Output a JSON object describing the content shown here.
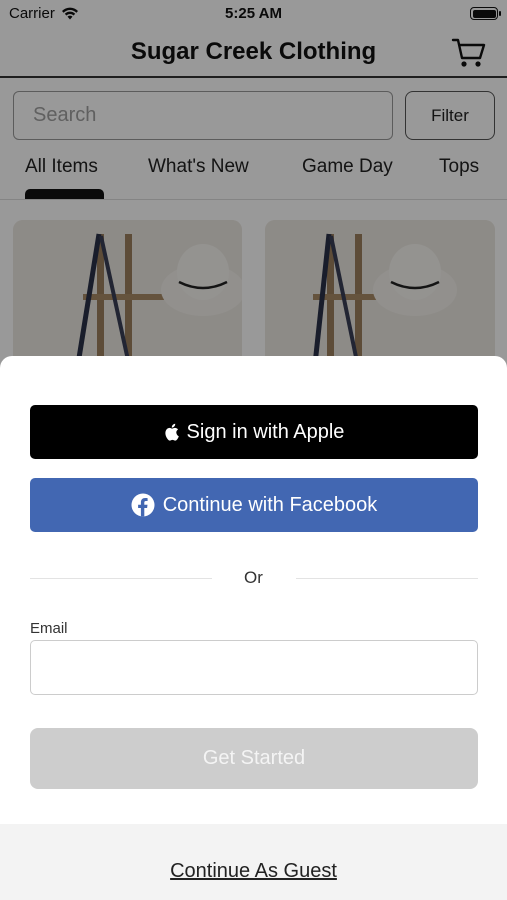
{
  "status_bar": {
    "carrier": "Carrier",
    "time": "5:25 AM"
  },
  "header": {
    "title": "Sugar Creek Clothing",
    "cart_icon": "cart-icon"
  },
  "search": {
    "placeholder": "Search",
    "filter_label": "Filter"
  },
  "tabs": [
    {
      "label": "All Items",
      "active": true
    },
    {
      "label": "What's New",
      "active": false
    },
    {
      "label": "Game Day",
      "active": false
    },
    {
      "label": "Tops",
      "active": false
    }
  ],
  "sheet": {
    "apple_label": "Sign in with Apple",
    "facebook_label": "Continue with Facebook",
    "divider_text": "Or",
    "email_label": "Email",
    "email_value": "",
    "get_started_label": "Get Started",
    "guest_label": "Continue As Guest"
  },
  "colors": {
    "apple_button": "#000000",
    "facebook_button": "#4267b2",
    "get_started_disabled": "#cdcdcd",
    "overlay": "rgba(0,0,0,0.4)"
  }
}
